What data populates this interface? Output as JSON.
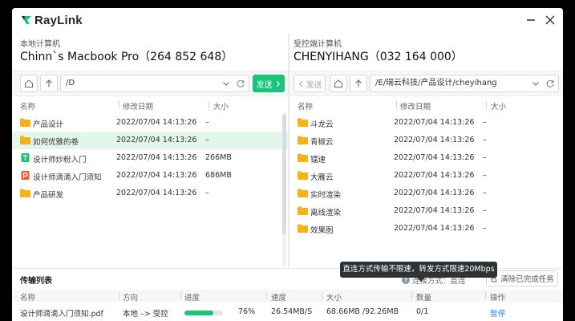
{
  "app": {
    "brand": "RayLink"
  },
  "colors": {
    "accent": "#17c47a",
    "folder": "#f6b318",
    "link": "#2f86e8"
  },
  "left": {
    "subtitle": "本地计算机",
    "title": "Chinn`s Macbook Pro（264 852 648）",
    "path": "/D",
    "send_label": "发送",
    "columns": {
      "name": "名称",
      "date": "修改日期",
      "size": "大小"
    },
    "files": [
      {
        "icon": "folder-icon",
        "name": "产品设计",
        "date": "2022/07/04 14:13:26",
        "size": "–"
      },
      {
        "icon": "folder-icon",
        "name": "如何优雅的卷",
        "date": "2022/07/04 14:13:26",
        "size": "–"
      },
      {
        "icon": "t-doc-icon",
        "name": "设计师炒粉入门",
        "date": "2022/07/04 14:13:26",
        "size": "266MB"
      },
      {
        "icon": "pdf-icon",
        "name": "设计师滴滴入门须知",
        "date": "2022/07/04 14:13:26",
        "size": "686MB"
      },
      {
        "icon": "folder-icon",
        "name": "产品研发",
        "date": "2022/07/04 14:13:26",
        "size": "–"
      }
    ]
  },
  "right": {
    "subtitle": "受控端计算机",
    "title": "CHENYIHANG（032 164 000）",
    "path": "/E/瑞云科技/产品设计/cheyihang",
    "send_label": "发送",
    "columns": {
      "name": "名称",
      "date": "修改日期",
      "size": "大小"
    },
    "files": [
      {
        "icon": "folder-icon",
        "name": "斗龙云",
        "date": "2022/07/04 14:13:26",
        "size": "–"
      },
      {
        "icon": "folder-icon",
        "name": "青椒云",
        "date": "2022/07/04 14:13:26",
        "size": "–"
      },
      {
        "icon": "folder-icon",
        "name": "镭速",
        "date": "2022/07/04 14:13:26",
        "size": "–"
      },
      {
        "icon": "folder-icon",
        "name": "大雁云",
        "date": "2022/07/04 14:13:26",
        "size": "–"
      },
      {
        "icon": "folder-icon",
        "name": "实时渲染",
        "date": "2022/07/04 14:13:26",
        "size": "–"
      },
      {
        "icon": "folder-icon",
        "name": "离线渲染",
        "date": "2022/07/04 14:13:26",
        "size": "–"
      },
      {
        "icon": "folder-icon",
        "name": "效果图",
        "date": "2022/07/04 14:13:26",
        "size": "–"
      }
    ]
  },
  "transfer": {
    "title": "传输列表",
    "connection": "连接方式：直连",
    "clear_label": "清除已完成任务",
    "tooltip": "直连方式传输不限速，转发方式限速20Mbps",
    "columns": {
      "name": "名称",
      "direction": "方向",
      "progress": "进度",
      "speed": "速度",
      "size": "大小",
      "count": "数量",
      "action": "操作"
    },
    "items": [
      {
        "name": "设计师滴滴入门须知.pdf",
        "direction": "本地 –> 受控",
        "progress": 76,
        "progress_label": "76%",
        "speed": "26.54MB/S",
        "size": "68.66MB /92.26MB",
        "count": "0/1",
        "action": "暂停"
      }
    ]
  }
}
